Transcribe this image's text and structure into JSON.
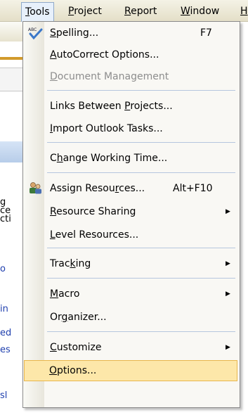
{
  "menubar": {
    "items": [
      {
        "pre": "",
        "ul": "T",
        "post": "ools"
      },
      {
        "pre": "",
        "ul": "P",
        "post": "roject"
      },
      {
        "pre": "",
        "ul": "R",
        "post": "eport"
      },
      {
        "pre": "",
        "ul": "W",
        "post": "indow"
      },
      {
        "pre": "",
        "ul": "H",
        "post": ""
      }
    ]
  },
  "background": {
    "fragments": [
      "g",
      "ce",
      "cti",
      "o",
      "in",
      "ed",
      "es",
      "sl"
    ]
  },
  "tools_menu": {
    "items": [
      {
        "pre": "",
        "ul": "S",
        "post": "pelling...",
        "shortcut": "F7",
        "icon": "spelling-abc-icon"
      },
      {
        "pre": "",
        "ul": "A",
        "post": "utoCorrect Options..."
      },
      {
        "pre": "",
        "ul": "D",
        "post": "ocument Management",
        "disabled": true
      },
      {
        "pre": "Links Between ",
        "ul": "P",
        "post": "rojects..."
      },
      {
        "pre": "",
        "ul": "I",
        "post": "mport Outlook Tasks..."
      },
      {
        "pre": "C",
        "ul": "h",
        "post": "ange Working Time..."
      },
      {
        "pre": "Assign Resou",
        "ul": "r",
        "post": "ces...",
        "shortcut": "Alt+F10",
        "icon": "assign-resources-icon"
      },
      {
        "pre": "",
        "ul": "R",
        "post": "esource Sharing",
        "submenu": "▶"
      },
      {
        "pre": "",
        "ul": "L",
        "post": "evel Resources..."
      },
      {
        "pre": "Trac",
        "ul": "k",
        "post": "ing",
        "submenu": "▶"
      },
      {
        "pre": "",
        "ul": "M",
        "post": "acro",
        "submenu": "▶"
      },
      {
        "pre": "Or",
        "ul": "g",
        "post": "anizer..."
      },
      {
        "pre": "",
        "ul": "C",
        "post": "ustomize",
        "submenu": "▶"
      },
      {
        "pre": "",
        "ul": "O",
        "post": "ptions...",
        "highlighted": true
      }
    ]
  }
}
